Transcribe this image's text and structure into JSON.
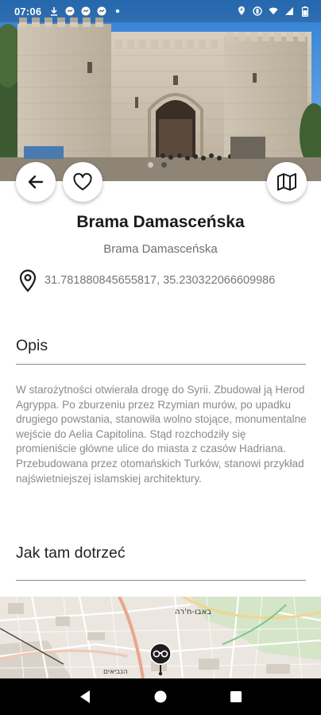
{
  "status_bar": {
    "time": "07:06",
    "left_icons": [
      "download-icon",
      "messenger-icon",
      "messenger-icon",
      "messenger-icon",
      "dot-icon"
    ],
    "right_icons": [
      "location-icon",
      "vibrate-icon",
      "wifi-icon",
      "signal-icon",
      "battery-icon"
    ]
  },
  "hero": {
    "image": "damascus-gate-photo",
    "slides": 2,
    "active_slide": 2
  },
  "actions": {
    "back_icon": "arrow-back-icon",
    "favorite_icon": "heart-outline-icon",
    "map_icon": "map-icon"
  },
  "place": {
    "title": "Brama Damasceńska",
    "subtitle": "Brama Damasceńska",
    "coordinates": "31.781880845655817, 35.230322066609986"
  },
  "description": {
    "heading": "Opis",
    "text": "W starożytności otwierała drogę do Syrii. Zbudował ją Herod Agryppa. Po zburzeniu przez Rzymian murów, po upadku drugiego powstania, stanowiła wolno stojące, monumentalne wejście do Aelia Capitolina. Stąd rozchodziły się promieniście główne ulice do miasta z czasów Hadriana. Przebudowana przez otomańskich Turków, stanowi przykład najświetniejszej islamskiej architektury."
  },
  "directions": {
    "heading": "Jak tam dotrzeć"
  },
  "map": {
    "street_label": "באבו-ח'רה",
    "street_label_2": "הנביאים",
    "marker_icon": "binoculars-marker-icon"
  },
  "nav": {
    "back": "nav-back-icon",
    "home": "nav-home-icon",
    "recents": "nav-recents-icon"
  },
  "colors": {
    "accent": "#222222",
    "muted_text": "#8a8a8a",
    "navbar": "#000000"
  }
}
